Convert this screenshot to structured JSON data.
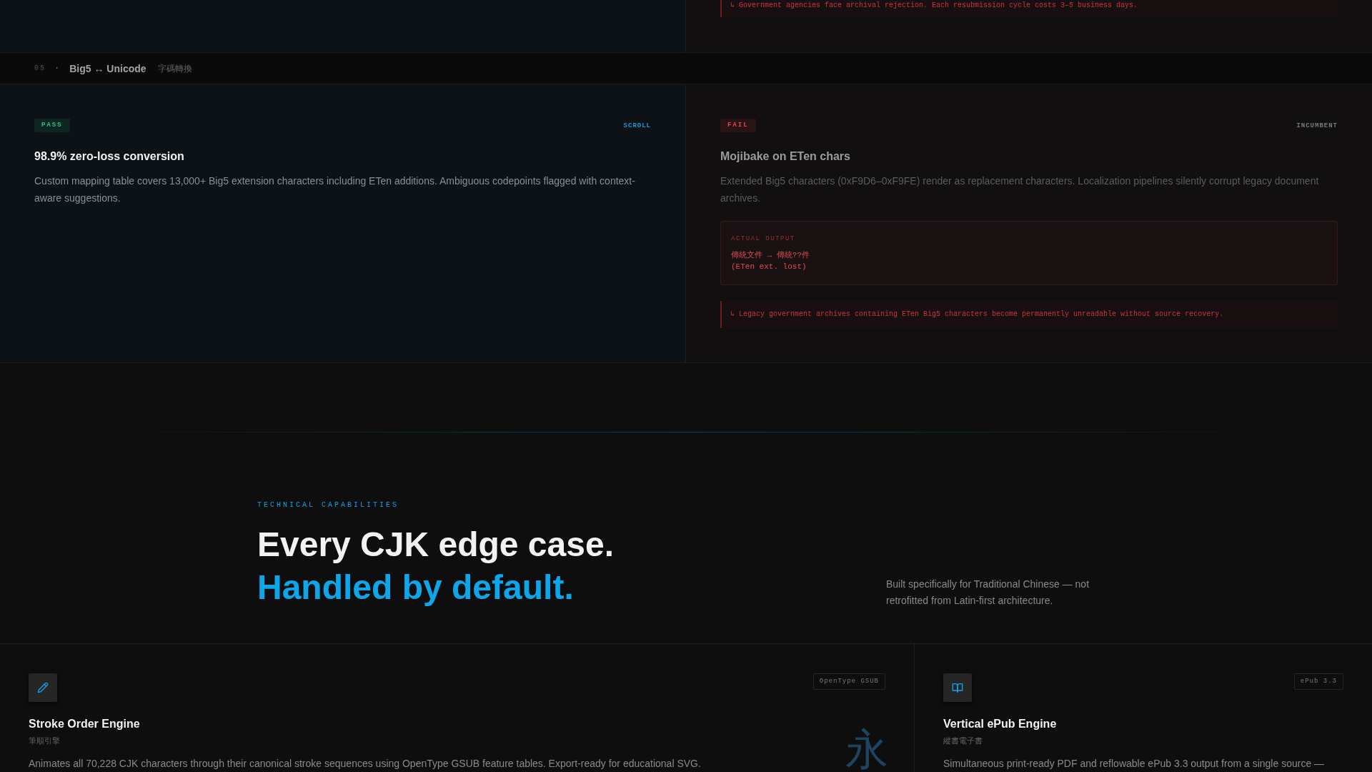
{
  "previous_row": {
    "fail_note": "↳ Government agencies face archival rejection. Each resubmission cycle costs 3–5 business days."
  },
  "comparison_rows": [
    {
      "number": "05",
      "separator": "·",
      "title": "Big5 ↔ Unicode",
      "subtitle": "字碼轉換",
      "cells": [
        {
          "kind": "pass",
          "status": "PASS",
          "tag": "SCROLL",
          "title": "98.9% zero-loss conversion",
          "description": "Custom mapping table covers 13,000+ Big5 extension characters including ETen additions. Ambiguous codepoints flagged with context-aware suggestions."
        },
        {
          "kind": "fail",
          "status": "FAIL",
          "tag": "INCUMBENT",
          "title": "Mojibake on ETen chars",
          "description": "Extended Big5 characters (0xF9D6–0xF9FE) render as replacement characters. Localization pipelines silently corrupt legacy document archives.",
          "output": {
            "label": "ACTUAL OUTPUT",
            "lines": [
              "傳統文件 → 傳統??件",
              "(ETen ext. lost)"
            ]
          },
          "note": "↳ Legacy government archives containing ETen Big5 characters become permanently unreadable without source recovery."
        }
      ]
    }
  ],
  "capabilities": {
    "eyebrow": "TECHNICAL CAPABILITIES",
    "heading": "Every CJK edge case.",
    "heading_accent": "Handled by default.",
    "description": "Built specifically for Traditional Chinese — not retrofitted from Latin-first architecture."
  },
  "features": [
    {
      "title": "Stroke Order Engine",
      "subtitle": "筆順引擎",
      "tag": "OpenType GSUB",
      "description": "Animates all 70,228 CJK characters through their canonical stroke sequences using OpenType GSUB feature tables. Export-ready for educational SVG.",
      "backdrop_glyph": "永"
    },
    {
      "title": "Vertical ePub Engine",
      "subtitle": "縱書電子書",
      "tag": "ePub 3.3",
      "description": "Simultaneous print-ready PDF and reflowable ePub 3.3 output from a single source —"
    }
  ]
}
